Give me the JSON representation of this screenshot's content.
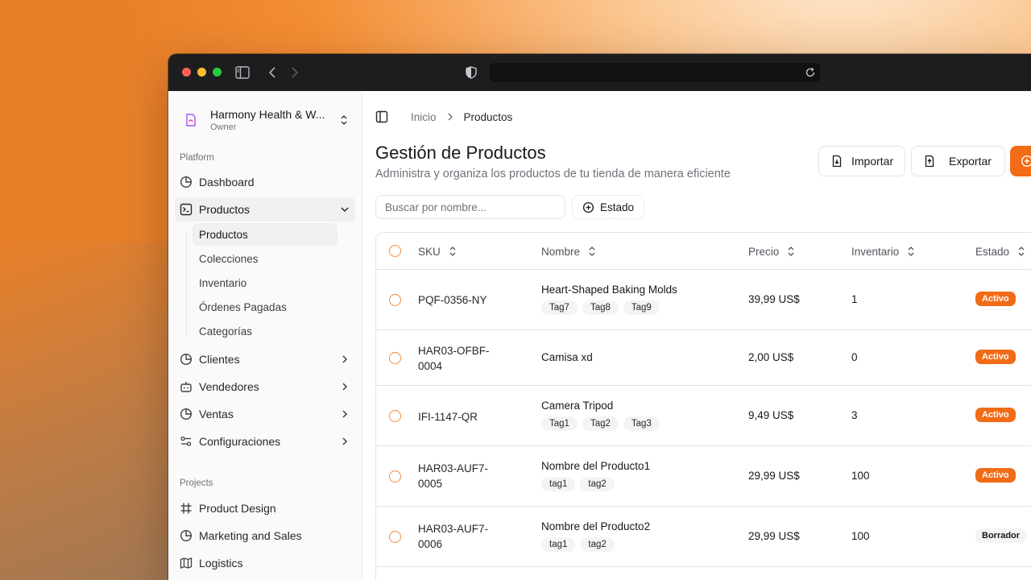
{
  "sidebar": {
    "org": {
      "name": "Harmony Health & W...",
      "role": "Owner"
    },
    "platform_label": "Platform",
    "nav": [
      {
        "label": "Dashboard",
        "icon": "pie-chart-icon"
      },
      {
        "label": "Productos",
        "icon": "terminal-square-icon"
      },
      {
        "label": "Clientes",
        "icon": "pie-chart-icon"
      },
      {
        "label": "Vendedores",
        "icon": "bot-icon"
      },
      {
        "label": "Ventas",
        "icon": "pie-chart-icon"
      },
      {
        "label": "Configuraciones",
        "icon": "settings-sliders-icon"
      }
    ],
    "productos_sub": [
      "Productos",
      "Colecciones",
      "Inventario",
      "Órdenes Pagadas",
      "Categorías"
    ],
    "projects_label": "Projects",
    "projects": [
      {
        "label": "Product Design",
        "icon": "frame-icon"
      },
      {
        "label": "Marketing and Sales",
        "icon": "pie-chart-icon"
      },
      {
        "label": "Logistics",
        "icon": "map-icon"
      }
    ]
  },
  "breadcrumb": {
    "home": "Inicio",
    "current": "Productos"
  },
  "page": {
    "title": "Gestión de Productos",
    "subtitle": "Administra y organiza los productos de tu tienda de manera eficiente",
    "import_label": "Importar",
    "export_label": "Exportar"
  },
  "filters": {
    "search_placeholder": "Buscar por nombre...",
    "status_label": "Estado"
  },
  "table": {
    "headers": {
      "sku": "SKU",
      "name": "Nombre",
      "price": "Precio",
      "inventory": "Inventario",
      "status": "Estado"
    },
    "rows": [
      {
        "sku": "PQF-0356-NY",
        "name": "Heart-Shaped Baking Molds",
        "tags": [
          "Tag7",
          "Tag8",
          "Tag9"
        ],
        "price": "39,99 US$",
        "inventory": "1",
        "status": "Activo"
      },
      {
        "sku": "HAR03-OFBF-0004",
        "name": "Camisa xd",
        "tags": [],
        "price": "2,00 US$",
        "inventory": "0",
        "status": "Activo"
      },
      {
        "sku": "IFI-1147-QR",
        "name": "Camera Tripod",
        "tags": [
          "Tag1",
          "Tag2",
          "Tag3"
        ],
        "price": "9,49 US$",
        "inventory": "3",
        "status": "Activo"
      },
      {
        "sku": "HAR03-AUF7-0005",
        "name": "Nombre del Producto1",
        "tags": [
          "tag1",
          "tag2"
        ],
        "price": "29,99 US$",
        "inventory": "100",
        "status": "Activo"
      },
      {
        "sku": "HAR03-AUF7-0006",
        "name": "Nombre del Producto2",
        "tags": [
          "tag1",
          "tag2"
        ],
        "price": "29,99 US$",
        "inventory": "100",
        "status": "Borrador"
      }
    ]
  },
  "colors": {
    "accent": "#f26b16",
    "titlebar": "#1d1d1f"
  }
}
